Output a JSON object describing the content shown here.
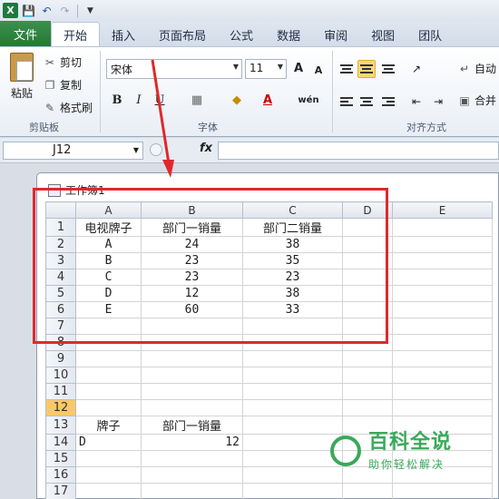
{
  "quick_access": {
    "app_icon": "X"
  },
  "tabs": [
    "文件",
    "开始",
    "插入",
    "页面布局",
    "公式",
    "数据",
    "审阅",
    "视图",
    "团队"
  ],
  "ribbon": {
    "clipboard": {
      "paste": "粘贴",
      "cut": "剪切",
      "copy": "复制",
      "format_painter": "格式刷",
      "title": "剪贴板"
    },
    "font": {
      "name": "宋体",
      "size": "11",
      "title": "字体",
      "grow": "A",
      "shrink": "A",
      "bold": "B",
      "italic": "I",
      "underline": "U",
      "font_color": "A",
      "phonetic": "wén"
    },
    "alignment": {
      "title": "对齐方式",
      "wrap": "自动",
      "merge": "合并"
    }
  },
  "formula_bar": {
    "name_box": "J12",
    "fx": "fx",
    "value": ""
  },
  "workbook": {
    "title": "工作簿1"
  },
  "sheet": {
    "columns": [
      "A",
      "B",
      "C",
      "D",
      "E"
    ],
    "rows": [
      {
        "n": "1",
        "a": "电视牌子",
        "b": "部门一销量",
        "c": "部门二销量"
      },
      {
        "n": "2",
        "a": "A",
        "b": "24",
        "c": "38"
      },
      {
        "n": "3",
        "a": "B",
        "b": "23",
        "c": "35"
      },
      {
        "n": "4",
        "a": "C",
        "b": "23",
        "c": "23"
      },
      {
        "n": "5",
        "a": "D",
        "b": "12",
        "c": "38"
      },
      {
        "n": "6",
        "a": "E",
        "b": "60",
        "c": "33"
      },
      {
        "n": "7",
        "a": "",
        "b": "",
        "c": ""
      },
      {
        "n": "8",
        "a": "",
        "b": "",
        "c": ""
      },
      {
        "n": "9",
        "a": "",
        "b": "",
        "c": ""
      },
      {
        "n": "10",
        "a": "",
        "b": "",
        "c": ""
      },
      {
        "n": "11",
        "a": "",
        "b": "",
        "c": ""
      },
      {
        "n": "12",
        "a": "",
        "b": "",
        "c": ""
      },
      {
        "n": "13",
        "a": "牌子",
        "b": "部门一销量",
        "c": ""
      },
      {
        "n": "14",
        "a": "D",
        "b": "12",
        "c": ""
      },
      {
        "n": "15",
        "a": "",
        "b": "",
        "c": ""
      },
      {
        "n": "16",
        "a": "",
        "b": "",
        "c": ""
      },
      {
        "n": "17",
        "a": "",
        "b": "",
        "c": ""
      }
    ],
    "selected_row": "12"
  },
  "watermark": {
    "title": "百科全说",
    "subtitle": "助你轻松解决"
  },
  "colors": {
    "excel_green": "#227a34",
    "highlight_red": "#e0282c",
    "selected_row": "#f8c86a"
  }
}
